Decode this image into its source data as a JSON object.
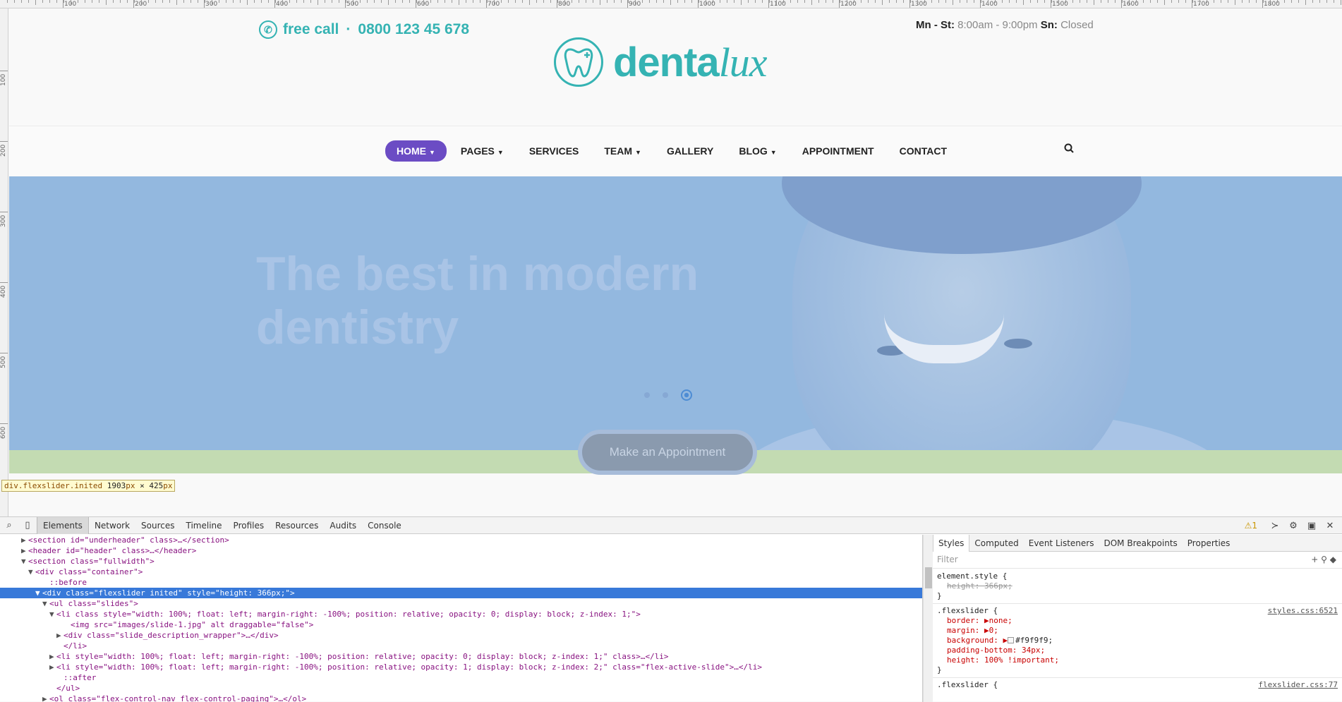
{
  "ruler": {
    "top_labels": [
      "100",
      "200",
      "300",
      "400",
      "500",
      "600",
      "700",
      "800",
      "900",
      "1000",
      "1100",
      "1200",
      "1300",
      "1400",
      "1500",
      "1600",
      "1700",
      "1800"
    ],
    "left_labels": [
      "100",
      "200",
      "300",
      "400",
      "500",
      "600"
    ]
  },
  "topbar": {
    "call_label": "free call",
    "separator": "·",
    "phone": "0800 123 45 678",
    "hours_mn_label": "Mn - St:",
    "hours_mn_value": "8:00am - 9:00pm",
    "hours_sn_label": "Sn:",
    "hours_sn_value": "Closed"
  },
  "logo": {
    "text_main": "denta",
    "text_script": "lux"
  },
  "nav": {
    "items": [
      {
        "label": "HOME",
        "caret": true,
        "active": true
      },
      {
        "label": "PAGES",
        "caret": true
      },
      {
        "label": "SERVICES"
      },
      {
        "label": "TEAM",
        "caret": true
      },
      {
        "label": "GALLERY"
      },
      {
        "label": "BLOG",
        "caret": true
      },
      {
        "label": "APPOINTMENT"
      },
      {
        "label": "CONTACT"
      }
    ],
    "search_icon": "search-icon"
  },
  "hero": {
    "title": "The best in modern dentistry",
    "appointment_button": "Make an Appointment",
    "slides_count": 3,
    "active_slide": 3
  },
  "tooltip": {
    "selector": "div.flexslider.inited",
    "width": "1903",
    "height": "425",
    "unit": "px",
    "times": "×"
  },
  "devtools": {
    "tabs": [
      "Elements",
      "Network",
      "Sources",
      "Timeline",
      "Profiles",
      "Resources",
      "Audits",
      "Console"
    ],
    "active_tab": "Elements",
    "warnings": "1",
    "elements": [
      {
        "indent": 3,
        "tri": "▶",
        "text": "<section id=\"underheader\" class>…</section>"
      },
      {
        "indent": 3,
        "tri": "▶",
        "text": "<header id=\"header\" class>…</header>"
      },
      {
        "indent": 3,
        "tri": "▼",
        "text": "<section class=\"fullwidth\">"
      },
      {
        "indent": 4,
        "tri": "▼",
        "text": "<div class=\"container\">"
      },
      {
        "indent": 6,
        "tri": "",
        "text": "::before"
      },
      {
        "indent": 5,
        "tri": "▼",
        "text": "<div class=\"flexslider inited\" style=\"height: 366px;\">",
        "selected": true
      },
      {
        "indent": 6,
        "tri": "▼",
        "text": "<ul class=\"slides\">"
      },
      {
        "indent": 7,
        "tri": "▼",
        "text": "<li class style=\"width: 100%; float: left; margin-right: -100%; position: relative; opacity: 0; display: block; z-index: 1;\">"
      },
      {
        "indent": 9,
        "tri": "",
        "text": "<img src=\"images/slide-1.jpg\" alt draggable=\"false\">"
      },
      {
        "indent": 8,
        "tri": "▶",
        "text": "<div class=\"slide_description_wrapper\">…</div>"
      },
      {
        "indent": 8,
        "tri": "",
        "text": "</li>"
      },
      {
        "indent": 7,
        "tri": "▶",
        "text": "<li style=\"width: 100%; float: left; margin-right: -100%; position: relative; opacity: 0; display: block; z-index: 1;\" class>…</li>"
      },
      {
        "indent": 7,
        "tri": "▶",
        "text": "<li style=\"width: 100%; float: left; margin-right: -100%; position: relative; opacity: 1; display: block; z-index: 2;\" class=\"flex-active-slide\">…</li>"
      },
      {
        "indent": 8,
        "tri": "",
        "text": "::after"
      },
      {
        "indent": 7,
        "tri": "",
        "text": "</ul>"
      },
      {
        "indent": 6,
        "tri": "▶",
        "text": "<ol class=\"flex-control-nav flex-control-paging\">…</ol>"
      }
    ],
    "styles_tabs": [
      "Styles",
      "Computed",
      "Event Listeners",
      "DOM Breakpoints",
      "Properties"
    ],
    "filter_placeholder": "Filter",
    "rules": {
      "element_style_selector": "element.style {",
      "element_style_prop": "height: 366px;",
      "close": "}",
      "flexslider_selector": ".flexslider {",
      "flexslider_source": "styles.css:6521",
      "border": "border: ▶none;",
      "margin": "margin: ▶0;",
      "background_prop": "background: ▶",
      "background_value": "#f9f9f9;",
      "padding": "padding-bottom: 34px;",
      "height": "height: 100% !important;",
      "flexslider2_selector": ".flexslider {",
      "flexslider2_source": "flexslider.css:77"
    }
  },
  "colors": {
    "accent": "#35b3b3",
    "nav_active": "#6b4cc4",
    "selection": "#3879d9"
  }
}
